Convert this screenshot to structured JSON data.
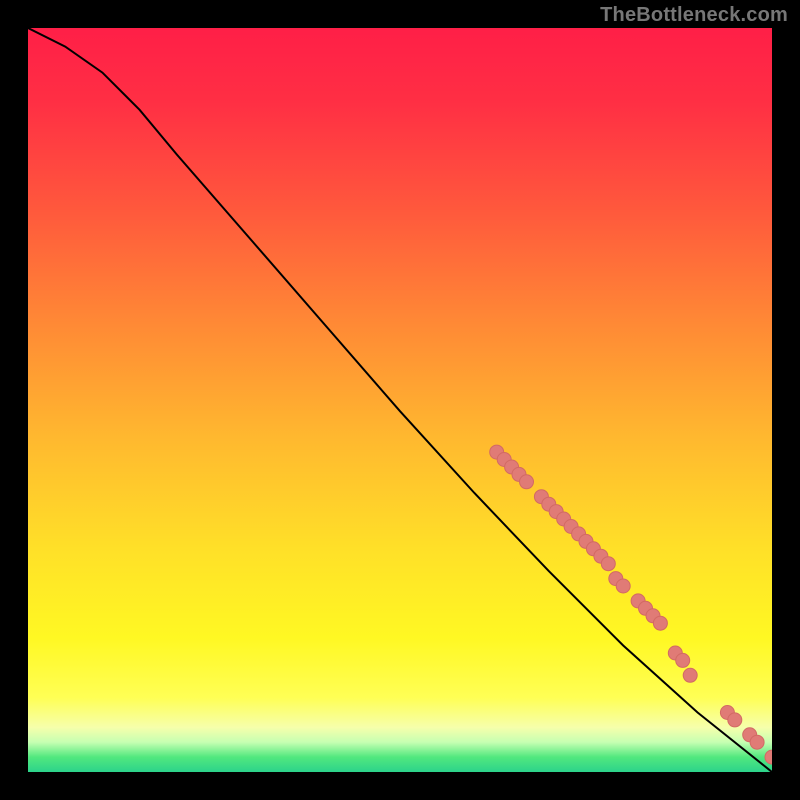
{
  "attribution": "TheBottleneck.com",
  "colors": {
    "page_bg": "#000000",
    "attribution_text": "#777777",
    "curve": "#000000",
    "dot_fill": "#e07b76",
    "dot_stroke": "#d26a64"
  },
  "chart_data": {
    "type": "line",
    "title": "",
    "xlabel": "",
    "ylabel": "",
    "xlim": [
      0,
      100
    ],
    "ylim": [
      0,
      100
    ],
    "grid": false,
    "legend": false,
    "curve_points": [
      {
        "x": 0,
        "y": 100
      },
      {
        "x": 5,
        "y": 97.5
      },
      {
        "x": 10,
        "y": 94
      },
      {
        "x": 15,
        "y": 89
      },
      {
        "x": 20,
        "y": 83
      },
      {
        "x": 30,
        "y": 71.5
      },
      {
        "x": 40,
        "y": 60
      },
      {
        "x": 50,
        "y": 48.5
      },
      {
        "x": 60,
        "y": 37.5
      },
      {
        "x": 70,
        "y": 27
      },
      {
        "x": 80,
        "y": 17
      },
      {
        "x": 90,
        "y": 8
      },
      {
        "x": 100,
        "y": 0
      }
    ],
    "scatter_points": [
      {
        "x": 63,
        "y": 43
      },
      {
        "x": 64,
        "y": 42
      },
      {
        "x": 65,
        "y": 41
      },
      {
        "x": 66,
        "y": 40
      },
      {
        "x": 67,
        "y": 39
      },
      {
        "x": 69,
        "y": 37
      },
      {
        "x": 70,
        "y": 36
      },
      {
        "x": 71,
        "y": 35
      },
      {
        "x": 72,
        "y": 34
      },
      {
        "x": 73,
        "y": 33
      },
      {
        "x": 74,
        "y": 32
      },
      {
        "x": 75,
        "y": 31
      },
      {
        "x": 76,
        "y": 30
      },
      {
        "x": 77,
        "y": 29
      },
      {
        "x": 78,
        "y": 28
      },
      {
        "x": 79,
        "y": 26
      },
      {
        "x": 80,
        "y": 25
      },
      {
        "x": 82,
        "y": 23
      },
      {
        "x": 83,
        "y": 22
      },
      {
        "x": 84,
        "y": 21
      },
      {
        "x": 85,
        "y": 20
      },
      {
        "x": 87,
        "y": 16
      },
      {
        "x": 88,
        "y": 15
      },
      {
        "x": 89,
        "y": 13
      },
      {
        "x": 94,
        "y": 8
      },
      {
        "x": 95,
        "y": 7
      },
      {
        "x": 97,
        "y": 5
      },
      {
        "x": 98,
        "y": 4
      },
      {
        "x": 100,
        "y": 2
      },
      {
        "x": 101,
        "y": 1.5
      }
    ]
  }
}
